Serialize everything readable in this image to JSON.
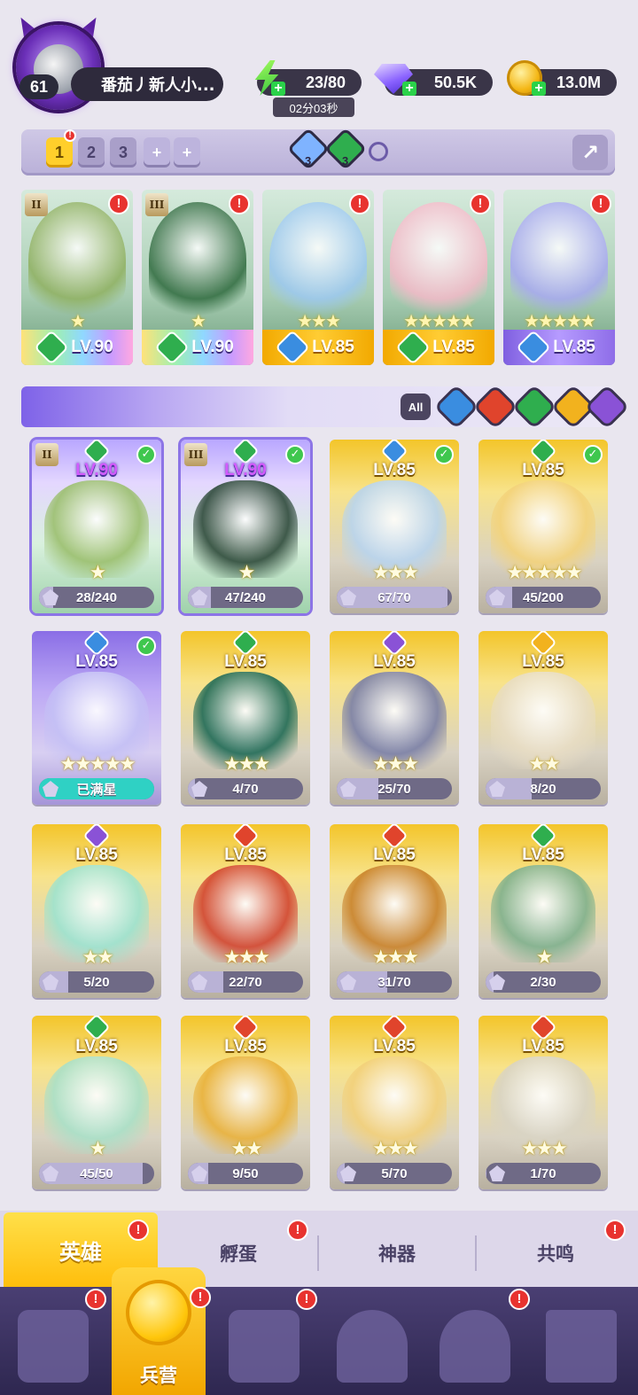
{
  "player": {
    "level": "61",
    "name": "番茄丿新人小..."
  },
  "resources": {
    "energy": "23/80",
    "energy_timer": "02分03秒",
    "gems": "50.5K",
    "gold": "13.0M"
  },
  "team_bar": {
    "tabs": [
      "1",
      "2",
      "3",
      "+",
      "+"
    ],
    "active_tab": "1",
    "element_counts": [
      {
        "element": "water",
        "count": "3",
        "color": "#7fb3ff"
      },
      {
        "element": "grass",
        "count": "3",
        "color": "#2fae4e"
      }
    ]
  },
  "formation": [
    {
      "level": "LV.90",
      "rank": "II",
      "element_color": "#2fae4e",
      "stars": "★",
      "art_color": "#8fb060",
      "frame": "rainbow"
    },
    {
      "level": "LV.90",
      "rank": "III",
      "element_color": "#2fae4e",
      "stars": "★",
      "art_color": "#2f6a3e",
      "frame": "rainbow"
    },
    {
      "level": "LV.85",
      "rank": "",
      "element_color": "#3a8de0",
      "stars": "★★★",
      "art_color": "#9cc8f0",
      "frame": "gold"
    },
    {
      "level": "LV.85",
      "rank": "",
      "element_color": "#2fae4e",
      "stars": "★★★★★",
      "art_color": "#f4b9c8",
      "frame": "gold"
    },
    {
      "level": "LV.85",
      "rank": "",
      "element_color": "#3a8de0",
      "stars": "★★★★★",
      "art_color": "#a7a8f0",
      "frame": "purple"
    }
  ],
  "filter": {
    "all_label": "All",
    "elements": [
      {
        "name": "water",
        "color": "#3a8de0"
      },
      {
        "name": "fire",
        "color": "#e0442c"
      },
      {
        "name": "grass",
        "color": "#2fae4e"
      },
      {
        "name": "light",
        "color": "#f2b21e"
      },
      {
        "name": "dark",
        "color": "#8a52d6"
      }
    ]
  },
  "heroes": [
    {
      "level": "LV.90",
      "rank": "II",
      "element_color": "#2fae4e",
      "stars": "★",
      "shards": "28/240",
      "progress": 0.12,
      "frame": "rainbow",
      "checked": true,
      "art_color": "#9bbf6e"
    },
    {
      "level": "LV.90",
      "rank": "III",
      "element_color": "#2fae4e",
      "stars": "★",
      "shards": "47/240",
      "progress": 0.2,
      "frame": "rainbow",
      "checked": true,
      "art_color": "#2e4a3a"
    },
    {
      "level": "LV.85",
      "rank": "",
      "element_color": "#3a8de0",
      "stars": "★★★",
      "shards": "67/70",
      "progress": 0.96,
      "frame": "gold",
      "checked": true,
      "art_color": "#b8d4ee"
    },
    {
      "level": "LV.85",
      "rank": "",
      "element_color": "#2fae4e",
      "stars": "★★★★★",
      "shards": "45/200",
      "progress": 0.23,
      "frame": "gold",
      "checked": true,
      "art_color": "#f3d27a"
    },
    {
      "level": "LV.85",
      "rank": "",
      "element_color": "#3a8de0",
      "stars": "★★★★★",
      "shards": "已满星",
      "progress": 1,
      "frame": "purple",
      "checked": true,
      "art_color": "#c4c0f5"
    },
    {
      "level": "LV.85",
      "rank": "",
      "element_color": "#2fae4e",
      "stars": "★★★",
      "shards": "4/70",
      "progress": 0.06,
      "frame": "gold",
      "checked": false,
      "art_color": "#1f6a56"
    },
    {
      "level": "LV.85",
      "rank": "",
      "element_color": "#8a52d6",
      "stars": "★★★",
      "shards": "25/70",
      "progress": 0.36,
      "frame": "gold",
      "checked": false,
      "art_color": "#7a7fa6"
    },
    {
      "level": "LV.85",
      "rank": "",
      "element_color": "#f2b21e",
      "stars": "★★",
      "shards": "8/20",
      "progress": 0.4,
      "frame": "gold",
      "checked": false,
      "art_color": "#e8ddc4"
    },
    {
      "level": "LV.85",
      "rank": "",
      "element_color": "#8a52d6",
      "stars": "★★",
      "shards": "5/20",
      "progress": 0.25,
      "frame": "gold",
      "checked": false,
      "art_color": "#9de3cf"
    },
    {
      "level": "LV.85",
      "rank": "",
      "element_color": "#e0442c",
      "stars": "★★★",
      "shards": "22/70",
      "progress": 0.31,
      "frame": "gold",
      "checked": false,
      "art_color": "#d2452e"
    },
    {
      "level": "LV.85",
      "rank": "",
      "element_color": "#e0442c",
      "stars": "★★★",
      "shards": "31/70",
      "progress": 0.44,
      "frame": "gold",
      "checked": false,
      "art_color": "#c9822a"
    },
    {
      "level": "LV.85",
      "rank": "",
      "element_color": "#2fae4e",
      "stars": "★",
      "shards": "2/30",
      "progress": 0.07,
      "frame": "gold",
      "checked": false,
      "art_color": "#7fb08c"
    },
    {
      "level": "LV.85",
      "rank": "",
      "element_color": "#2fae4e",
      "stars": "★",
      "shards": "45/50",
      "progress": 0.9,
      "frame": "gold",
      "checked": false,
      "art_color": "#a9e0c8"
    },
    {
      "level": "LV.85",
      "rank": "",
      "element_color": "#e0442c",
      "stars": "★★",
      "shards": "9/50",
      "progress": 0.18,
      "frame": "gold",
      "checked": false,
      "art_color": "#e9b13a"
    },
    {
      "level": "LV.85",
      "rank": "",
      "element_color": "#e0442c",
      "stars": "★★★",
      "shards": "5/70",
      "progress": 0.07,
      "frame": "gold",
      "checked": false,
      "art_color": "#f2d07a"
    },
    {
      "level": "LV.85",
      "rank": "",
      "element_color": "#e0442c",
      "stars": "★★★",
      "shards": "1/70",
      "progress": 0.01,
      "frame": "gold",
      "checked": false,
      "art_color": "#d9d4c4"
    }
  ],
  "sub_tabs": [
    "英雄",
    "孵蛋",
    "神器",
    "共鸣"
  ],
  "bottom_nav": {
    "active_label": "兵营",
    "icons": [
      "cards-icon",
      "barracks-icon",
      "scroll-icon",
      "castle-icon",
      "mushroom-icon",
      "banner-icon"
    ]
  }
}
